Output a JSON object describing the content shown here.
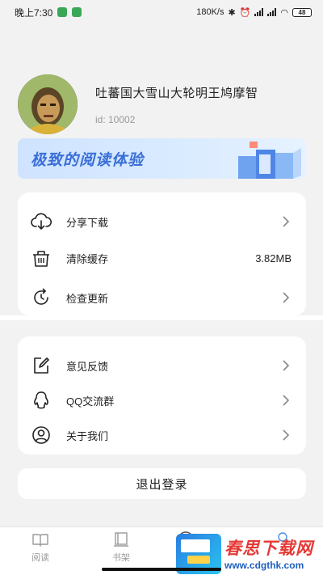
{
  "status_bar": {
    "time": "晚上7:30",
    "network_speed": "180K/s",
    "battery": "48"
  },
  "profile": {
    "username": "吐蕃国大雪山大轮明王鸠摩智",
    "user_id": "id: 10002"
  },
  "banner": {
    "text": "极致的阅读体验"
  },
  "menu_group_1": [
    {
      "label": "分享下载",
      "icon": "cloud-download-icon",
      "trailing": "chevron"
    },
    {
      "label": "清除缓存",
      "icon": "trash-icon",
      "value": "3.82MB"
    },
    {
      "label": "检查更新",
      "icon": "refresh-clock-icon",
      "trailing": "chevron"
    }
  ],
  "menu_group_2": [
    {
      "label": "意见反馈",
      "icon": "edit-icon",
      "trailing": "chevron"
    },
    {
      "label": "QQ交流群",
      "icon": "qq-icon",
      "trailing": "chevron"
    },
    {
      "label": "关于我们",
      "icon": "user-circle-icon",
      "trailing": "chevron"
    }
  ],
  "logout_label": "退出登录",
  "tabs": [
    {
      "label": "阅读",
      "icon": "book-open-icon"
    },
    {
      "label": "书架",
      "icon": "bookshelf-icon"
    }
  ],
  "watermark": {
    "title": "春思下载网",
    "url": "www.cdgthk.com"
  },
  "colors": {
    "background": "#f2f2f2",
    "banner_text": "#3a6fd8",
    "watermark_red": "#e53935",
    "watermark_blue": "#1f5fbf"
  }
}
